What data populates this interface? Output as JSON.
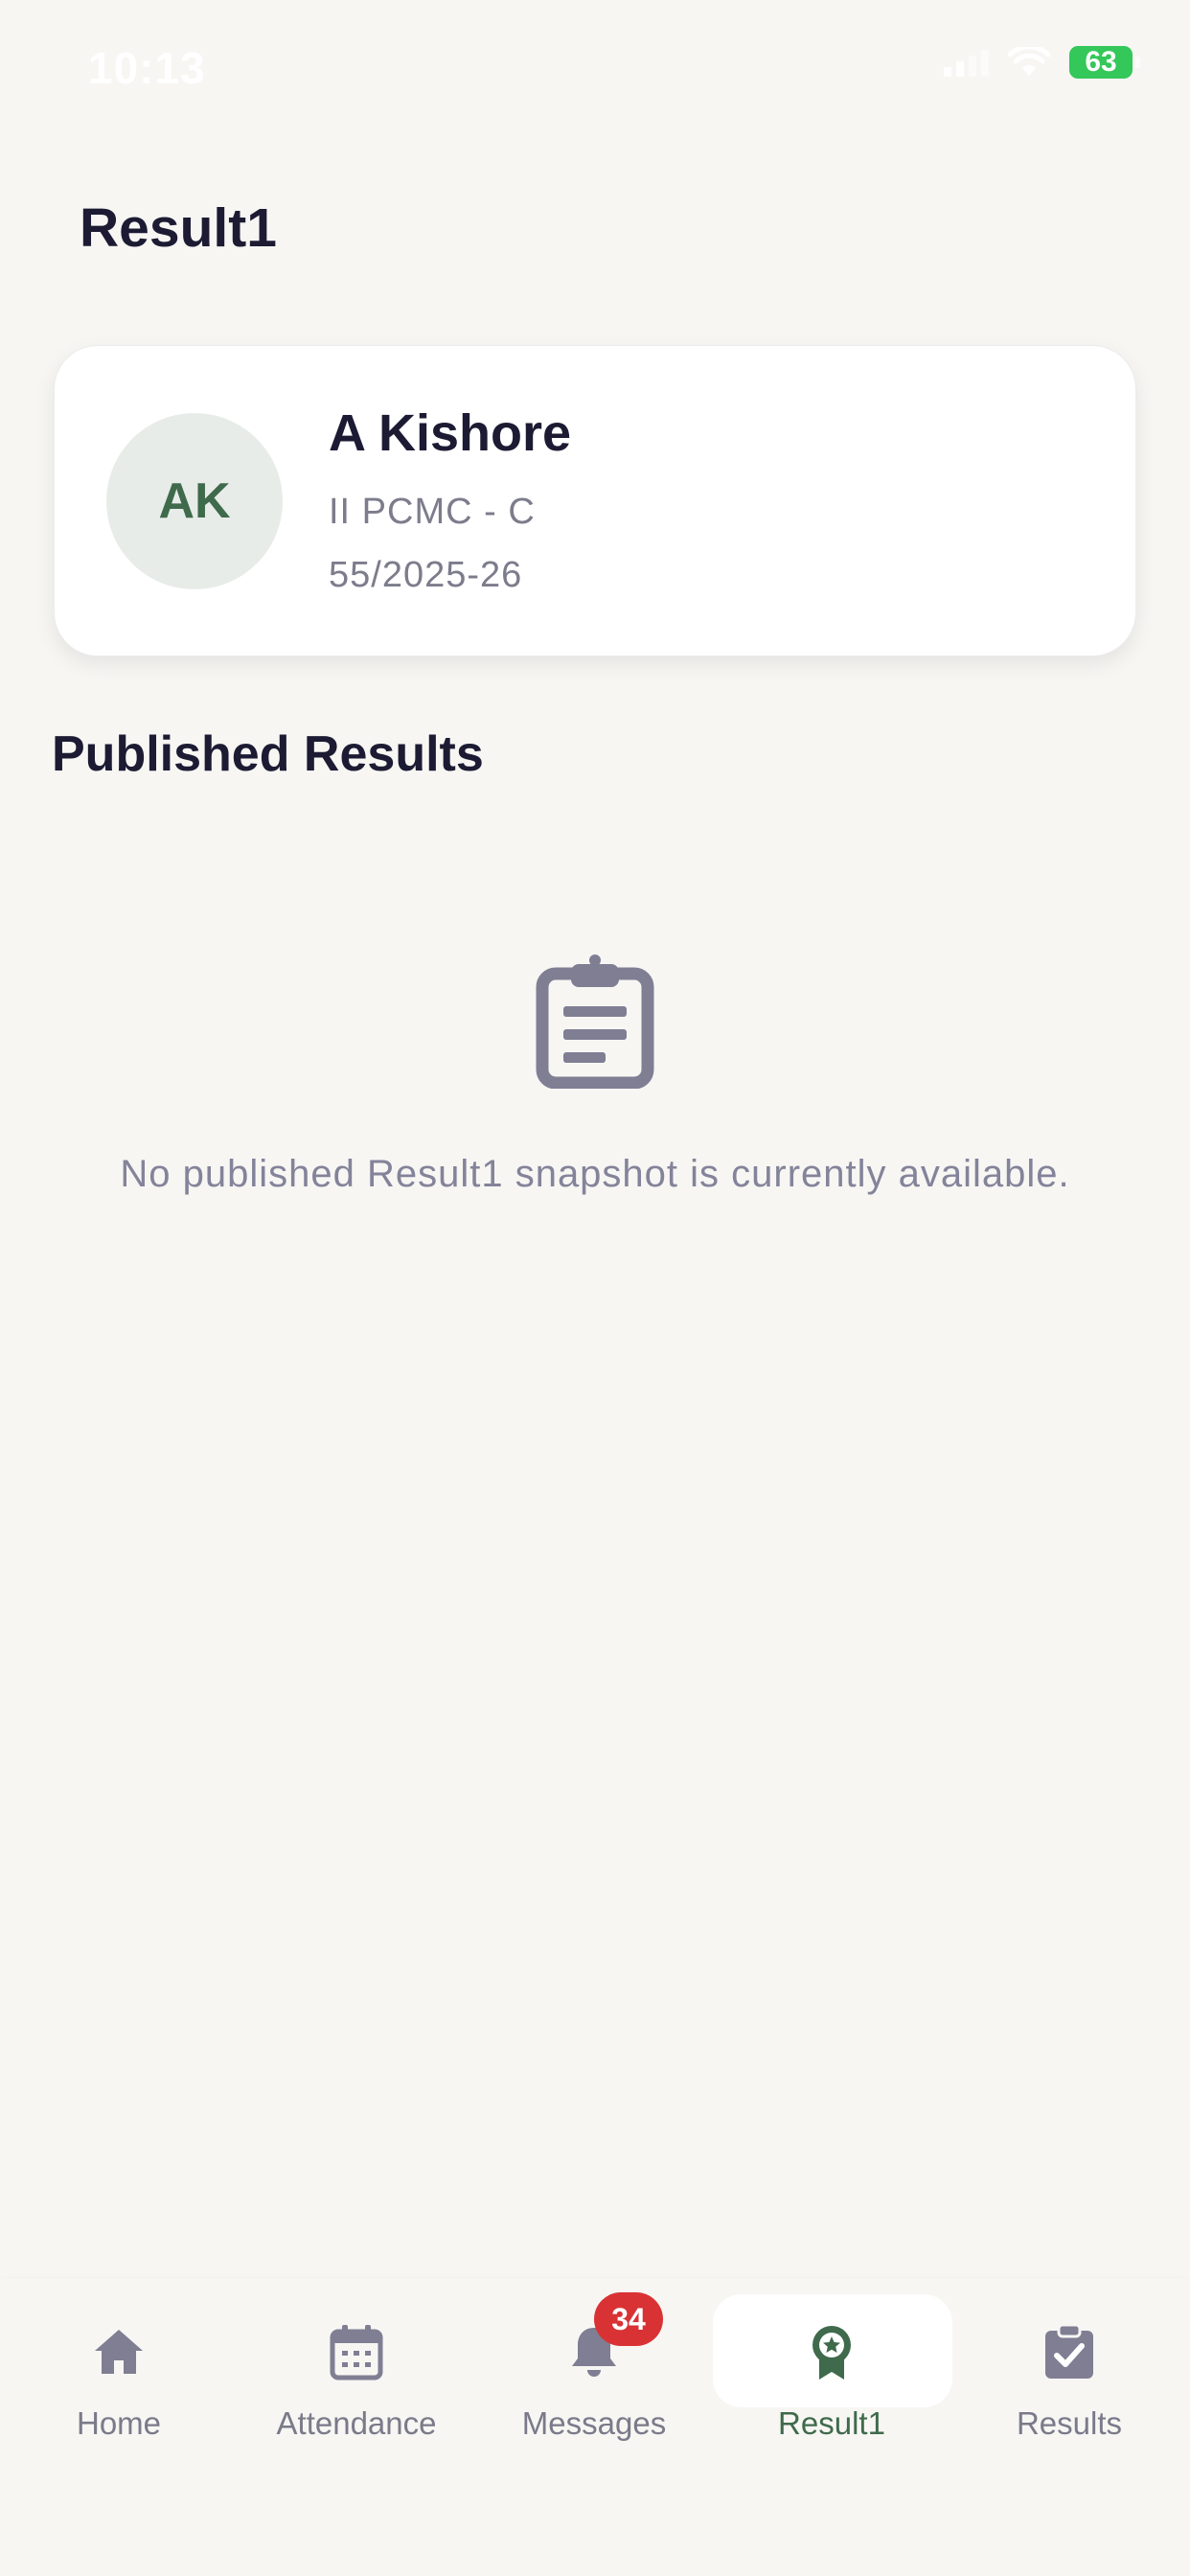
{
  "status_bar": {
    "time": "10:13",
    "battery": "63"
  },
  "header": {
    "title": "Result1"
  },
  "student": {
    "initials": "AK",
    "name": "A Kishore",
    "class": "II PCMC - C",
    "roll": "55/2025-26"
  },
  "section": {
    "title": "Published Results"
  },
  "empty_state": {
    "icon": "clipboard-icon",
    "message": "No published Result1 snapshot is currently available."
  },
  "bottom_nav": {
    "items": [
      {
        "label": "Home",
        "icon": "home-icon"
      },
      {
        "label": "Attendance",
        "icon": "calendar-icon"
      },
      {
        "label": "Messages",
        "icon": "bell-icon",
        "badge": "34"
      },
      {
        "label": "Result1",
        "icon": "award-icon",
        "active": true
      },
      {
        "label": "Results",
        "icon": "clipboard-check-icon"
      }
    ]
  },
  "colors": {
    "accent": "#3f6a4c",
    "background": "#f7f6f3",
    "badge": "#d93234",
    "muted_text": "#7c7c8c",
    "icon_gray": "#7f7e93"
  }
}
